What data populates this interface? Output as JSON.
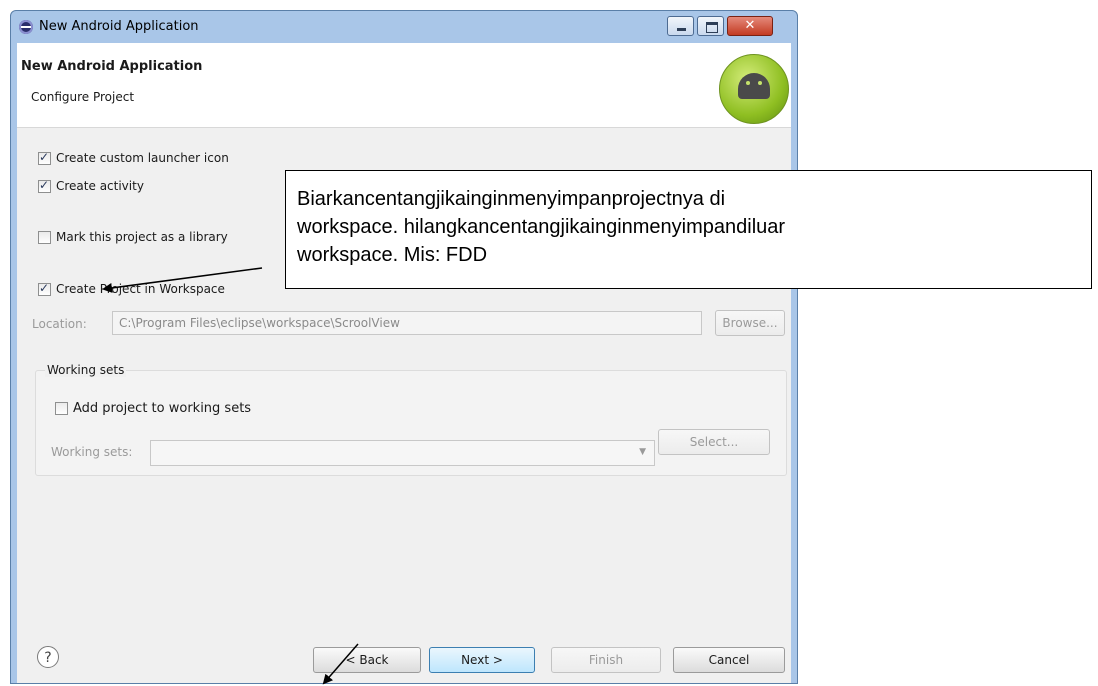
{
  "window": {
    "title": "New Android Application"
  },
  "header": {
    "title": "New Android Application",
    "subtitle": "Configure Project"
  },
  "options": {
    "launcher_icon": "Create custom launcher icon",
    "create_activity": "Create activity",
    "mark_library": "Mark this project as a library",
    "create_in_workspace": "Create Project in Workspace"
  },
  "location": {
    "label": "Location:",
    "value": "C:\\Program Files\\eclipse\\workspace\\ScroolView",
    "browse_label": "Browse..."
  },
  "working_sets": {
    "group_title": "Working sets",
    "add_label": "Add project to working sets",
    "field_label": "Working sets:",
    "select_label": "Select..."
  },
  "footer": {
    "back_label": "< Back",
    "next_label": "Next >",
    "finish_label": "Finish",
    "cancel_label": "Cancel"
  },
  "annotation": {
    "line1": "Biarkancentangjikainginmenyimpanprojectnya di",
    "line2": "workspace. hilangkancentangjikainginmenyimpandiluar",
    "line3": "workspace. Mis: FDD"
  }
}
